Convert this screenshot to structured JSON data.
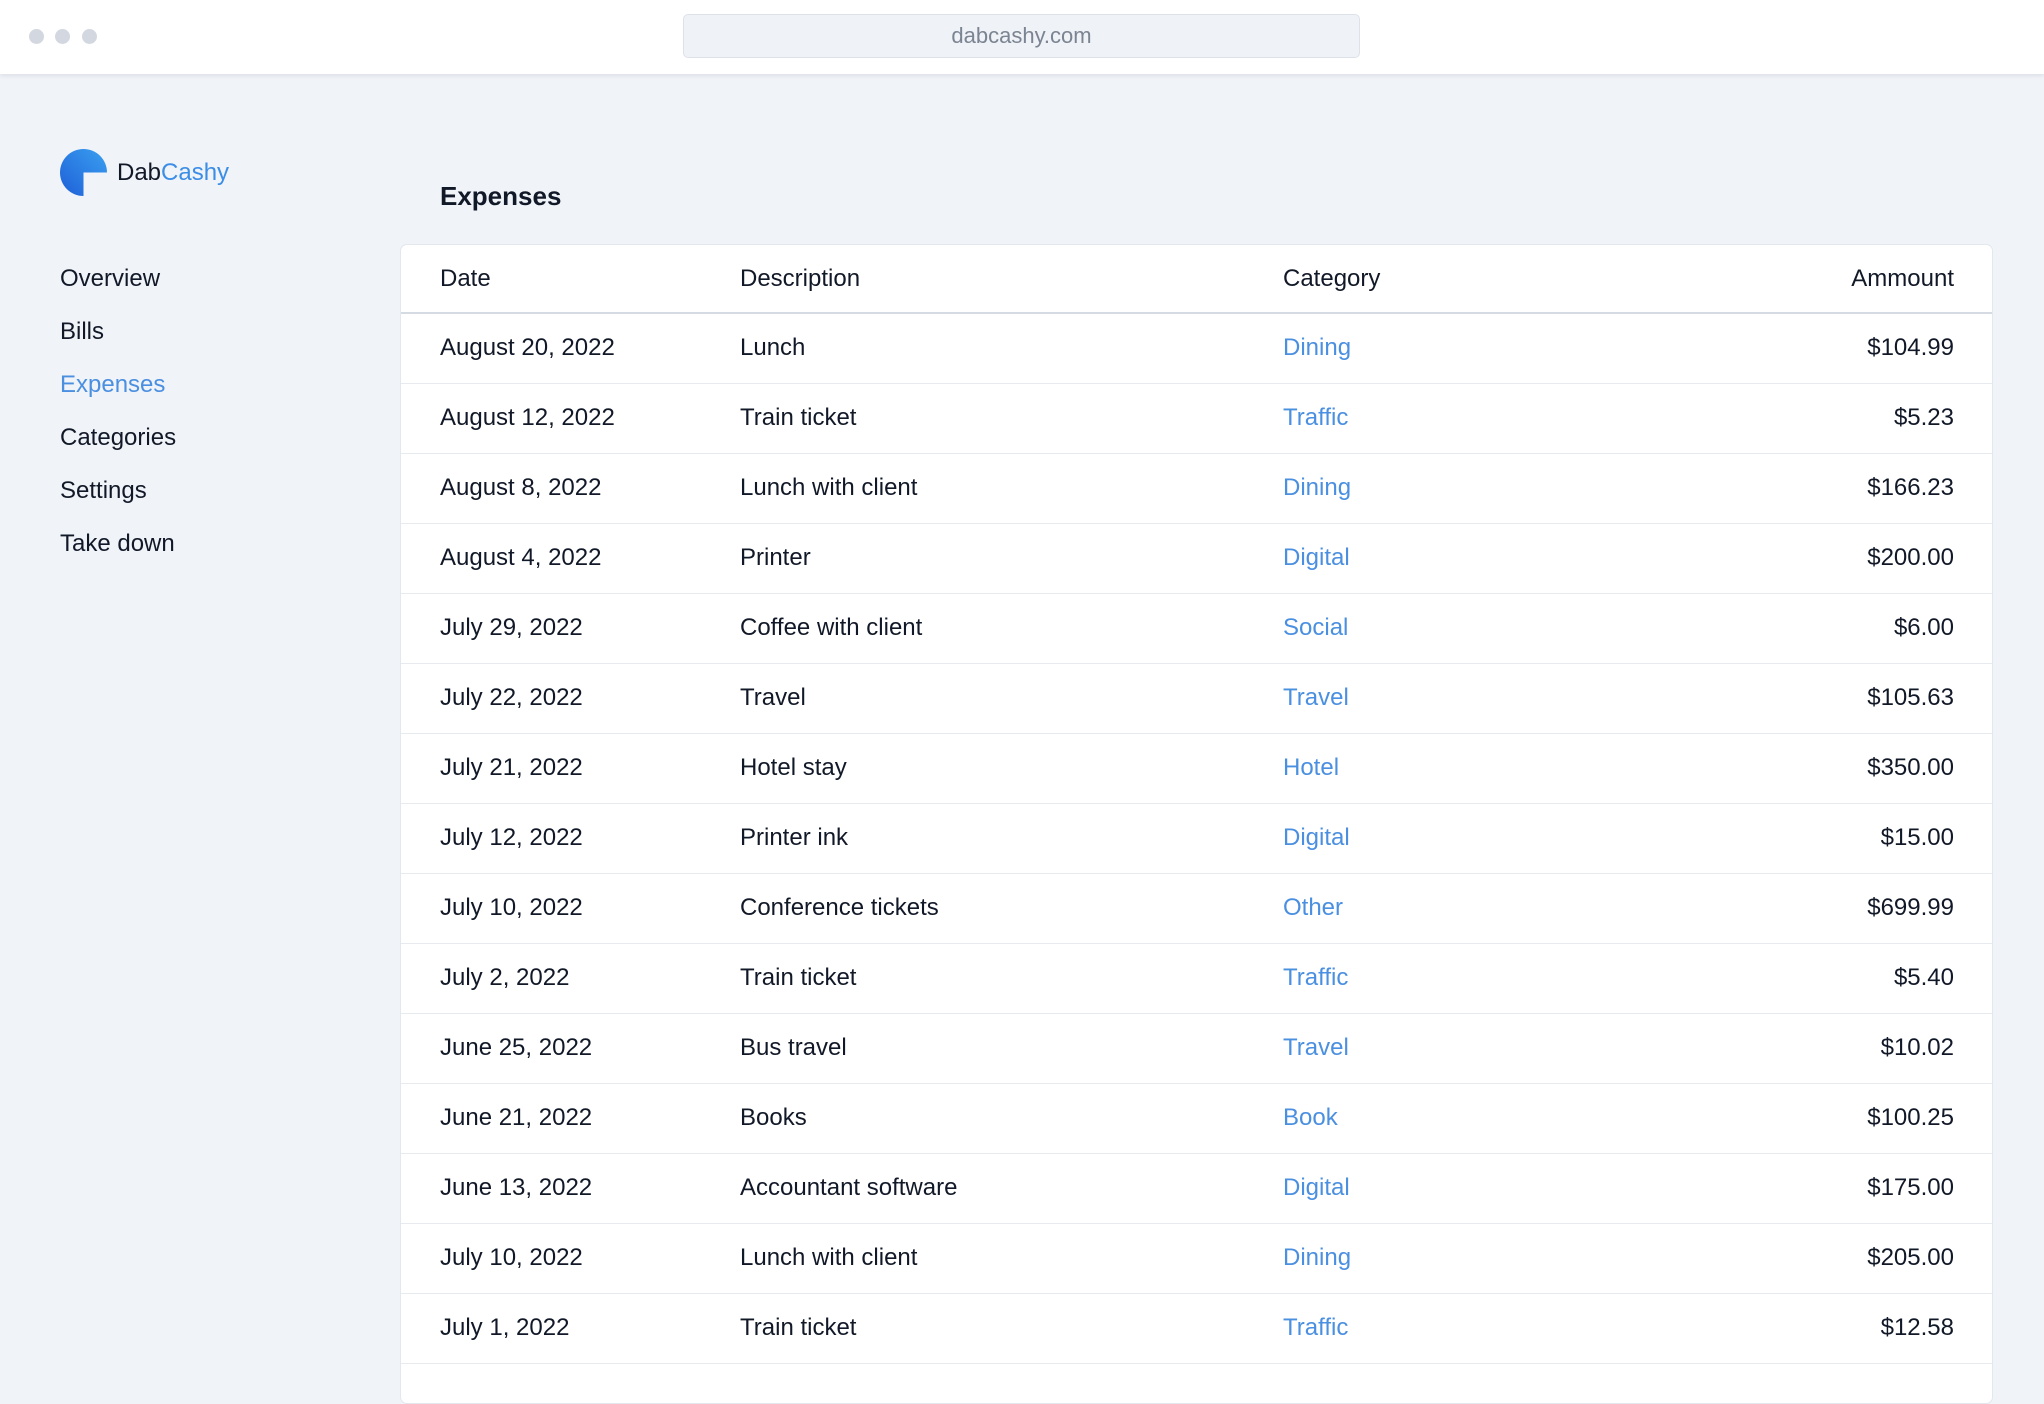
{
  "browser": {
    "url": "dabcashy.com"
  },
  "brand": {
    "name_prefix": "Dab",
    "name_suffix": "Cashy"
  },
  "sidebar": {
    "items": [
      {
        "label": "Overview",
        "active": false
      },
      {
        "label": "Bills",
        "active": false
      },
      {
        "label": "Expenses",
        "active": true
      },
      {
        "label": "Categories",
        "active": false
      },
      {
        "label": "Settings",
        "active": false
      },
      {
        "label": "Take down",
        "active": false
      }
    ]
  },
  "main": {
    "title": "Expenses",
    "columns": {
      "date": "Date",
      "description": "Description",
      "category": "Category",
      "amount": "Ammount"
    },
    "rows": [
      {
        "date": "August 20, 2022",
        "description": "Lunch",
        "category": "Dining",
        "amount": "$104.99"
      },
      {
        "date": "August 12, 2022",
        "description": "Train ticket",
        "category": "Traffic",
        "amount": "$5.23"
      },
      {
        "date": "August 8, 2022",
        "description": "Lunch with client",
        "category": "Dining",
        "amount": "$166.23"
      },
      {
        "date": "August 4, 2022",
        "description": "Printer",
        "category": "Digital",
        "amount": "$200.00"
      },
      {
        "date": "July 29, 2022",
        "description": "Coffee with client",
        "category": "Social",
        "amount": "$6.00"
      },
      {
        "date": "July 22, 2022",
        "description": "Travel",
        "category": "Travel",
        "amount": "$105.63"
      },
      {
        "date": "July 21, 2022",
        "description": "Hotel stay",
        "category": "Hotel",
        "amount": "$350.00"
      },
      {
        "date": "July 12, 2022",
        "description": "Printer ink",
        "category": "Digital",
        "amount": "$15.00"
      },
      {
        "date": "July 10, 2022",
        "description": "Conference tickets",
        "category": "Other",
        "amount": "$699.99"
      },
      {
        "date": "July 2, 2022",
        "description": "Train ticket",
        "category": "Traffic",
        "amount": "$5.40"
      },
      {
        "date": "June 25, 2022",
        "description": "Bus travel",
        "category": "Travel",
        "amount": "$10.02"
      },
      {
        "date": "June 21, 2022",
        "description": "Books",
        "category": "Book",
        "amount": "$100.25"
      },
      {
        "date": "June 13, 2022",
        "description": "Accountant software",
        "category": "Digital",
        "amount": "$175.00"
      },
      {
        "date": "July 10, 2022",
        "description": "Lunch with client",
        "category": "Dining",
        "amount": "$205.00"
      },
      {
        "date": "July 1, 2022",
        "description": "Train ticket",
        "category": "Traffic",
        "amount": "$12.58"
      }
    ]
  },
  "colors": {
    "accent": "#4a8fe0",
    "background": "#f0f3f8",
    "logo_gradient_start": "#1e5fd8",
    "logo_gradient_end": "#3aa0f0"
  },
  "icons": {
    "window_controls": "three-dot-icon",
    "logo": "dabcashy-logo-icon"
  }
}
